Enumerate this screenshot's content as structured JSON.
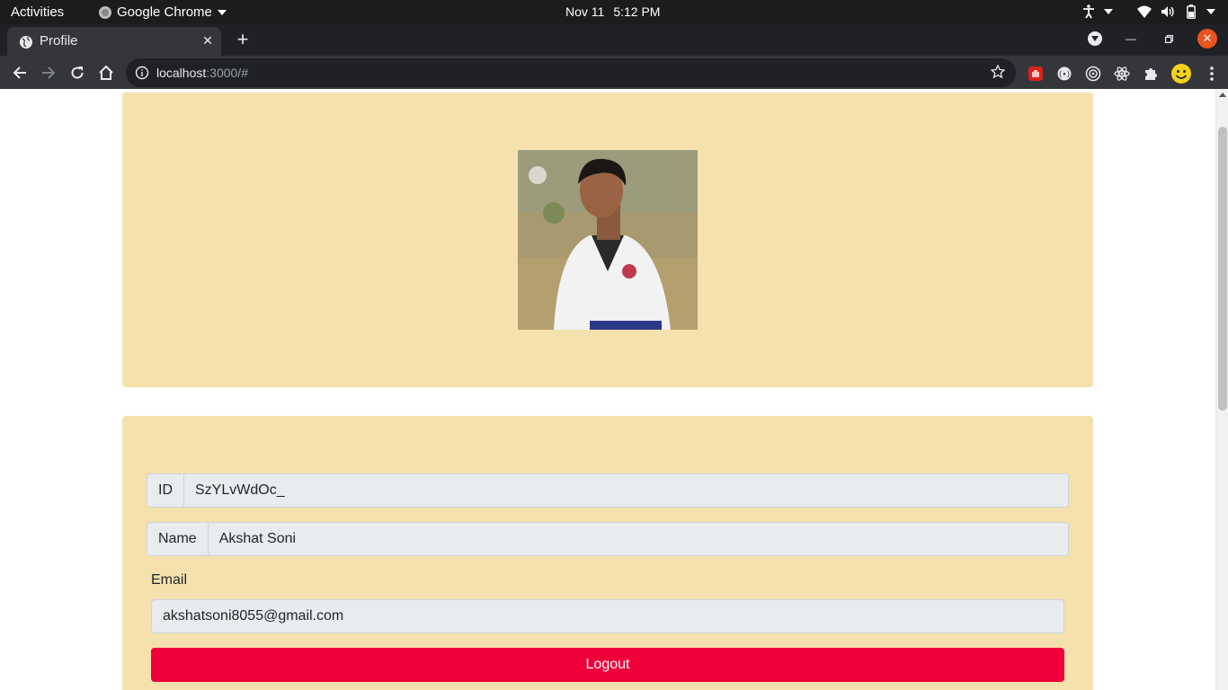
{
  "system": {
    "activities": "Activities",
    "app_name": "Google Chrome",
    "date": "Nov 11",
    "time": "5:12 PM"
  },
  "browser": {
    "tab_title": "Profile",
    "url_host": "localhost",
    "url_rest": ":3000/#"
  },
  "profile": {
    "photo_alt": "Profile photo",
    "id_label": "ID",
    "id_value": "SzYLvWdOc_",
    "name_label": "Name",
    "name_value": "Akshat Soni",
    "email_label": "Email",
    "email_value": "akshatsoni8055@gmail.com",
    "logout_label": "Logout"
  },
  "colors": {
    "card_bg": "#f5e1ae",
    "logout_bg": "#f0003a",
    "field_bg": "#e9ecef"
  }
}
